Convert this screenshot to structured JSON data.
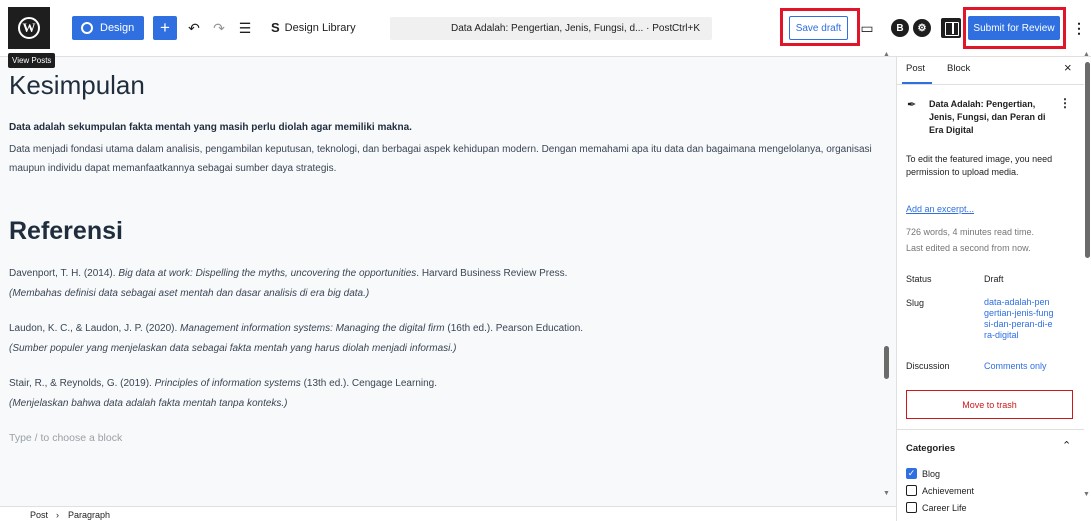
{
  "topbar": {
    "design_label": "Design",
    "design_library_label": "Design Library",
    "command_title": "Data Adalah: Pengertian, Jenis, Fungsi, d... · Post",
    "command_shortcut": "Ctrl+K",
    "save_draft_label": "Save draft",
    "submit_label": "Submit for Review",
    "tooltip": "View Posts"
  },
  "content": {
    "heading_conclusion": "Kesimpulan",
    "conclusion_bold": "Data adalah sekumpulan fakta mentah yang masih perlu diolah agar memiliki makna.",
    "conclusion_text": "Data menjadi fondasi utama dalam analisis, pengambilan keputusan, teknologi, dan berbagai aspek kehidupan modern. Dengan memahami apa itu data dan bagaimana mengelolanya, organisasi maupun individu dapat memanfaatkannya sebagai sumber daya strategis.",
    "heading_references": "Referensi",
    "references": [
      {
        "authors": "Davenport, T. H. (2014). ",
        "title": "Big data at work: Dispelling the myths, uncovering the opportunities",
        "rest": ". Harvard Business Review Press.",
        "note": "(Membahas definisi data sebagai aset mentah dan dasar analisis di era big data.)"
      },
      {
        "authors": "Laudon, K. C., & Laudon, J. P. (2020). ",
        "title": "Management information systems: Managing the digital firm",
        "rest": " (16th ed.). Pearson Education.",
        "note": "(Sumber populer yang menjelaskan data sebagai fakta mentah yang harus diolah menjadi informasi.)"
      },
      {
        "authors": "Stair, R., & Reynolds, G. (2019). ",
        "title": "Principles of information systems",
        "rest": " (13th ed.). Cengage Learning.",
        "note": "(Menjelaskan bahwa data adalah fakta mentah tanpa konteks.)"
      }
    ],
    "block_placeholder": "Type / to choose a block"
  },
  "breadcrumb": {
    "post": "Post",
    "separator": "›",
    "block": "Paragraph"
  },
  "sidebar": {
    "tab_post": "Post",
    "tab_block": "Block",
    "post_title": "Data Adalah: Pengertian, Jenis, Fungsi, dan Peran di Era Digital",
    "featured_image_note": "To edit the featured image, you need permission to upload media.",
    "excerpt_link": "Add an excerpt...",
    "word_count": "726 words, 4 minutes read time.",
    "last_edited": "Last edited a second from now.",
    "status_label": "Status",
    "status_value": "Draft",
    "slug_label": "Slug",
    "slug_value": "data-adalah-pengertian-jenis-fungsi-dan-peran-di-era-digital",
    "discussion_label": "Discussion",
    "discussion_value": "Comments only",
    "trash_label": "Move to trash",
    "categories_label": "Categories",
    "categories": [
      {
        "label": "Blog",
        "checked": true
      },
      {
        "label": "Achievement",
        "checked": false
      },
      {
        "label": "Career Life",
        "checked": false
      }
    ]
  },
  "colors": {
    "accent": "#2f6fe0",
    "highlight_box": "#e0152a",
    "trash": "#cc1818"
  }
}
